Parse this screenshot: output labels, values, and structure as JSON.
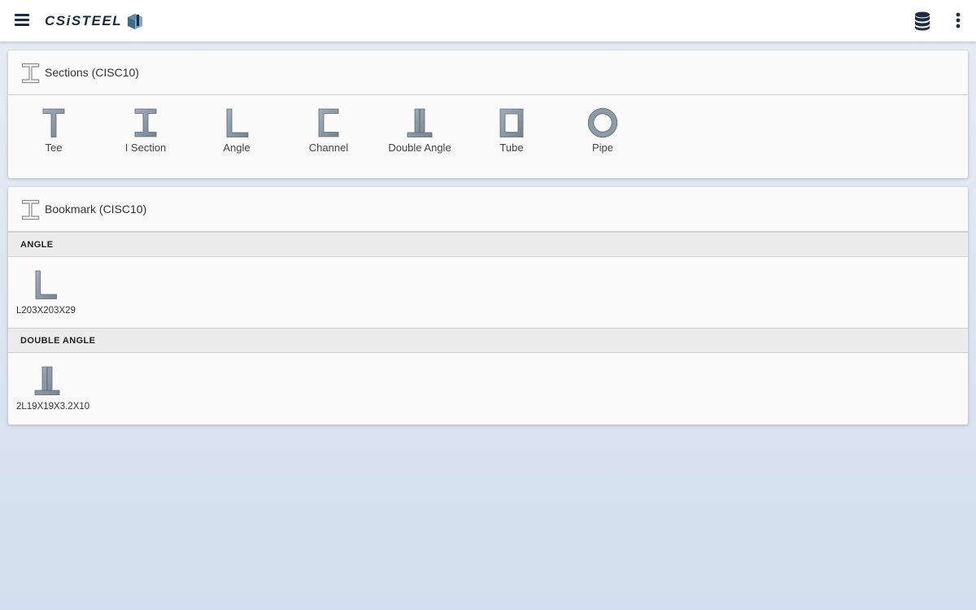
{
  "app": {
    "logo_text": "CSiSTEEL",
    "menu_icon": "hamburger-icon",
    "database_icon": "database-icon",
    "more_icon": "more-vertical-icon"
  },
  "sections": {
    "title": "Sections (CISC10)",
    "icon": "i-beam-icon",
    "shapes": [
      {
        "label": "Tee",
        "icon": "tee-section-icon"
      },
      {
        "label": "I Section",
        "icon": "i-section-icon"
      },
      {
        "label": "Angle",
        "icon": "angle-section-icon"
      },
      {
        "label": "Channel",
        "icon": "channel-section-icon"
      },
      {
        "label": "Double Angle",
        "icon": "double-angle-section-icon"
      },
      {
        "label": "Tube",
        "icon": "tube-section-icon"
      },
      {
        "label": "Pipe",
        "icon": "pipe-section-icon"
      }
    ]
  },
  "bookmarks": {
    "title": "Bookmark (CISC10)",
    "icon": "i-beam-icon",
    "groups": [
      {
        "header": "ANGLE",
        "items": [
          {
            "label": "L203X203X29",
            "icon": "angle-section-icon"
          }
        ]
      },
      {
        "header": "DOUBLE ANGLE",
        "items": [
          {
            "label": "2L19X19X3.2X10",
            "icon": "double-angle-section-icon"
          }
        ]
      }
    ]
  },
  "colors": {
    "shape_fill": "#8e9aa6",
    "shape_stroke": "#5f6b78",
    "brand_navy": "#1c2a44"
  }
}
